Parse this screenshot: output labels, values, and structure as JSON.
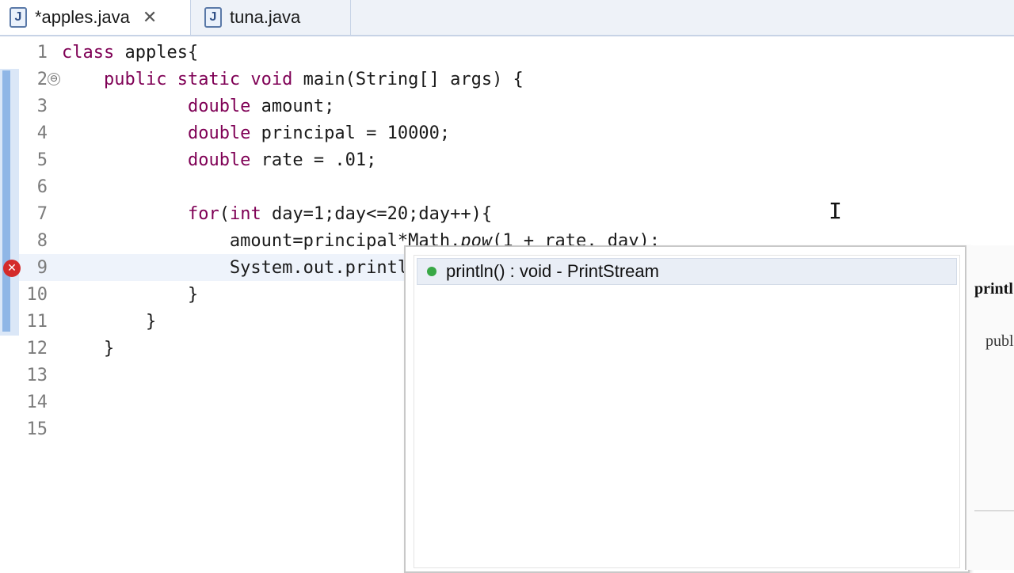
{
  "tabs": [
    {
      "label": "*apples.java",
      "icon": "java-file-icon",
      "active": true,
      "close": "✕"
    },
    {
      "label": "tuna.java",
      "icon": "java-file-icon",
      "active": false
    }
  ],
  "gutter": {
    "line_numbers": [
      "1",
      "2",
      "3",
      "4",
      "5",
      "6",
      "7",
      "8",
      "9",
      "10",
      "11",
      "12",
      "13",
      "14",
      "15"
    ],
    "fold_marker": "⊖",
    "error_marker": "✕"
  },
  "code": [
    {
      "pre": "",
      "kw": "class",
      "rest": " apples{"
    },
    {
      "pre": "    ",
      "kw": "public static void",
      "rest": " main(String[] args) {"
    },
    {
      "pre": "            ",
      "kw": "double",
      "rest": " amount;"
    },
    {
      "pre": "            ",
      "kw": "double",
      "rest": " principal = 10000;"
    },
    {
      "pre": "            ",
      "kw": "double",
      "rest": " rate = .01;"
    },
    {
      "pre": "",
      "kw": "",
      "rest": ""
    },
    {
      "pre": "            ",
      "kw": "for",
      "rest": "(",
      "kw2": "int",
      "rest2": " day=1;day<=20;day++){"
    },
    {
      "pre": "                ",
      "kw": "",
      "rest": "amount=principal*Math.",
      "italic": "pow",
      "rest2": "(1 + rate, day);"
    },
    {
      "pre": "                ",
      "kw": "",
      "rest": "System.out.println()"
    },
    {
      "pre": "            ",
      "kw": "",
      "rest": "}"
    },
    {
      "pre": "        ",
      "kw": "",
      "rest": "}"
    },
    {
      "pre": "    ",
      "kw": "",
      "rest": "}"
    },
    {
      "pre": "",
      "kw": "",
      "rest": ""
    },
    {
      "pre": "",
      "kw": "",
      "rest": ""
    },
    {
      "pre": "",
      "kw": "",
      "rest": ""
    }
  ],
  "content_assist": {
    "items": [
      {
        "label": "println() : void - PrintStream",
        "icon": "public-method-icon",
        "selected": true
      }
    ]
  },
  "javadoc": {
    "title": "printl",
    "text": "publ"
  },
  "colors": {
    "keyword": "#7f0055",
    "error": "#d42b2b",
    "method_icon": "#38a845"
  }
}
